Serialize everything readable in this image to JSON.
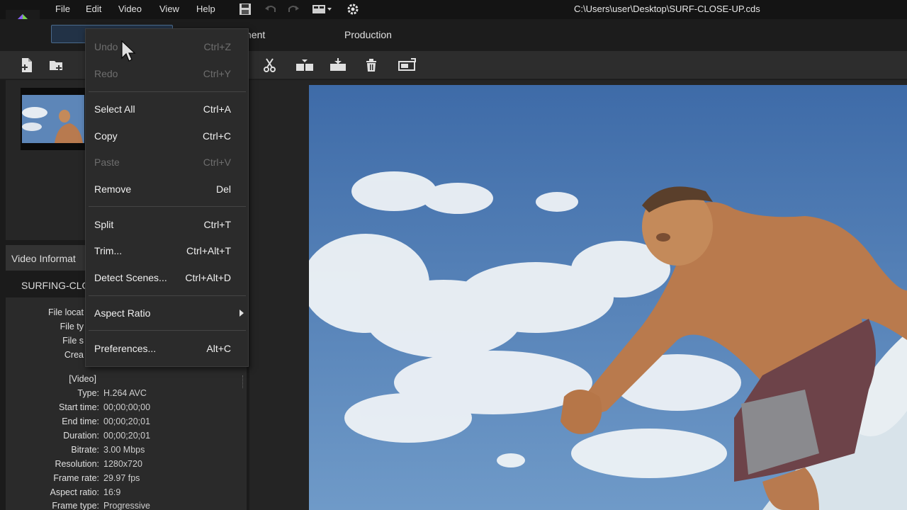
{
  "window": {
    "file_path": "C:\\Users\\user\\Desktop\\SURF-CLOSE-UP.cds"
  },
  "menubar": {
    "file": "File",
    "edit": "Edit",
    "video": "Video",
    "view": "View",
    "help": "Help"
  },
  "tabs": {
    "adjustment": "nent",
    "production": "Production"
  },
  "edit_menu": {
    "undo": {
      "label": "Undo",
      "shortcut": "Ctrl+Z"
    },
    "redo": {
      "label": "Redo",
      "shortcut": "Ctrl+Y"
    },
    "select_all": {
      "label": "Select All",
      "shortcut": "Ctrl+A"
    },
    "copy": {
      "label": "Copy",
      "shortcut": "Ctrl+C"
    },
    "paste": {
      "label": "Paste",
      "shortcut": "Ctrl+V"
    },
    "remove": {
      "label": "Remove",
      "shortcut": "Del"
    },
    "split": {
      "label": "Split",
      "shortcut": "Ctrl+T"
    },
    "trim": {
      "label": "Trim...",
      "shortcut": "Ctrl+Alt+T"
    },
    "detect_scenes": {
      "label": "Detect Scenes...",
      "shortcut": "Ctrl+Alt+D"
    },
    "aspect_ratio": {
      "label": "Aspect Ratio"
    },
    "preferences": {
      "label": "Preferences...",
      "shortcut": "Alt+C"
    }
  },
  "info_panel": {
    "title": "Video Informat",
    "clip_name": "SURFING-CLO",
    "file_labels": [
      "File locat",
      "File ty",
      "File s",
      "Crea"
    ],
    "video_section": "[Video]",
    "rows": [
      {
        "label": "Type:",
        "value": "H.264 AVC"
      },
      {
        "label": "Start time:",
        "value": "00;00;00;00"
      },
      {
        "label": "End time:",
        "value": "00;00;20;01"
      },
      {
        "label": "Duration:",
        "value": "00;00;20;01"
      },
      {
        "label": "Bitrate:",
        "value": "3.00 Mbps"
      },
      {
        "label": "Resolution:",
        "value": "1280x720"
      },
      {
        "label": "Frame rate:",
        "value": "29.97 fps"
      },
      {
        "label": "Aspect ratio:",
        "value": "16:9"
      },
      {
        "label": "Frame type:",
        "value": "Progressive"
      }
    ]
  },
  "colors": {
    "menu_bg": "#2b2b2b",
    "disabled_text": "#6e6e6e",
    "active_tab_border": "#4a6a8c",
    "sky": "#4f7cb8"
  }
}
